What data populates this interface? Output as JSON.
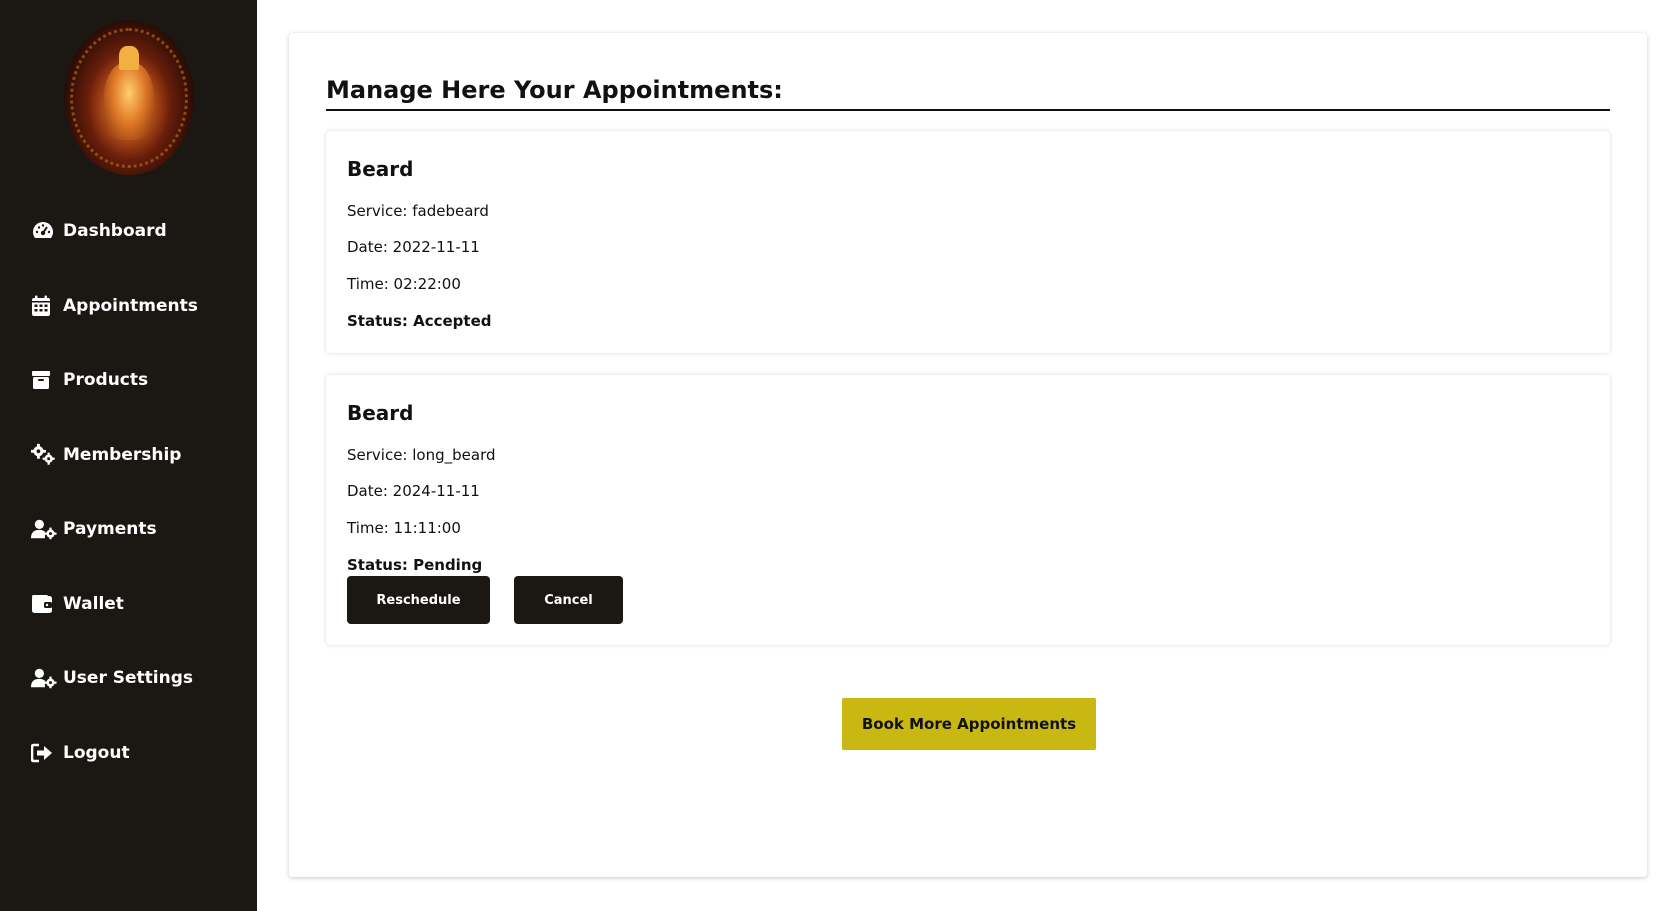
{
  "sidebar": {
    "items": [
      {
        "label": "Dashboard",
        "icon": "dashboard-gauge-icon"
      },
      {
        "label": "Appointments",
        "icon": "calendar-icon"
      },
      {
        "label": "Products",
        "icon": "box-icon"
      },
      {
        "label": "Membership",
        "icon": "gears-icon"
      },
      {
        "label": "Payments",
        "icon": "user-gear-icon"
      },
      {
        "label": "Wallet",
        "icon": "wallet-icon"
      },
      {
        "label": "User Settings",
        "icon": "user-gear-icon"
      },
      {
        "label": "Logout",
        "icon": "logout-icon"
      }
    ]
  },
  "main": {
    "title": "Manage Here Your Appointments:",
    "appointments": [
      {
        "title": "Beard",
        "service": "Service: fadebeard",
        "date": "Date: 2022-11-11",
        "time": "Time: 02:22:00",
        "status": "Status: Accepted"
      },
      {
        "title": "Beard",
        "service": "Service: long_beard",
        "date": "Date: 2024-11-11",
        "time": "Time: 11:11:00",
        "status": "Status: Pending",
        "reschedule_label": "Reschedule",
        "cancel_label": "Cancel"
      }
    ],
    "book_more_label": "Book More Appointments"
  },
  "colors": {
    "sidebar_bg": "#1b1712",
    "accent_yellow": "#c9b811",
    "dark_button": "#1b1712"
  }
}
